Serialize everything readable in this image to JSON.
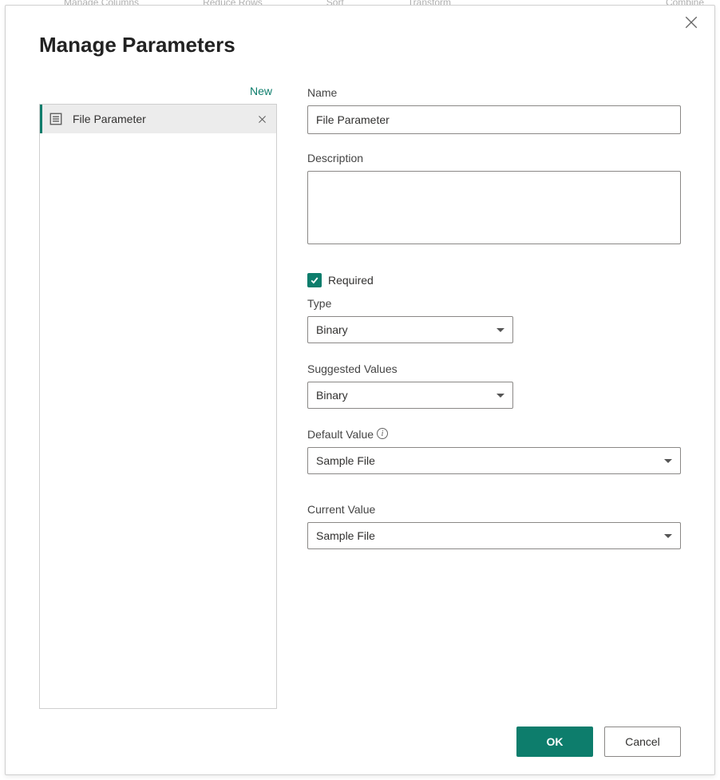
{
  "dialog": {
    "title": "Manage Parameters",
    "newLabel": "New"
  },
  "paramList": {
    "items": [
      {
        "label": "File Parameter"
      }
    ]
  },
  "form": {
    "nameLabel": "Name",
    "nameValue": "File Parameter",
    "descriptionLabel": "Description",
    "descriptionValue": "",
    "requiredLabel": "Required",
    "requiredChecked": true,
    "typeLabel": "Type",
    "typeValue": "Binary",
    "suggestedLabel": "Suggested Values",
    "suggestedValue": "Binary",
    "defaultLabel": "Default Value",
    "defaultValue": "Sample File",
    "currentLabel": "Current Value",
    "currentValue": "Sample File"
  },
  "footer": {
    "ok": "OK",
    "cancel": "Cancel"
  },
  "ribbon": {
    "a": "Manage Columns",
    "b": "Reduce Rows",
    "c": "Sort",
    "d": "Transform",
    "e": "Combine"
  }
}
